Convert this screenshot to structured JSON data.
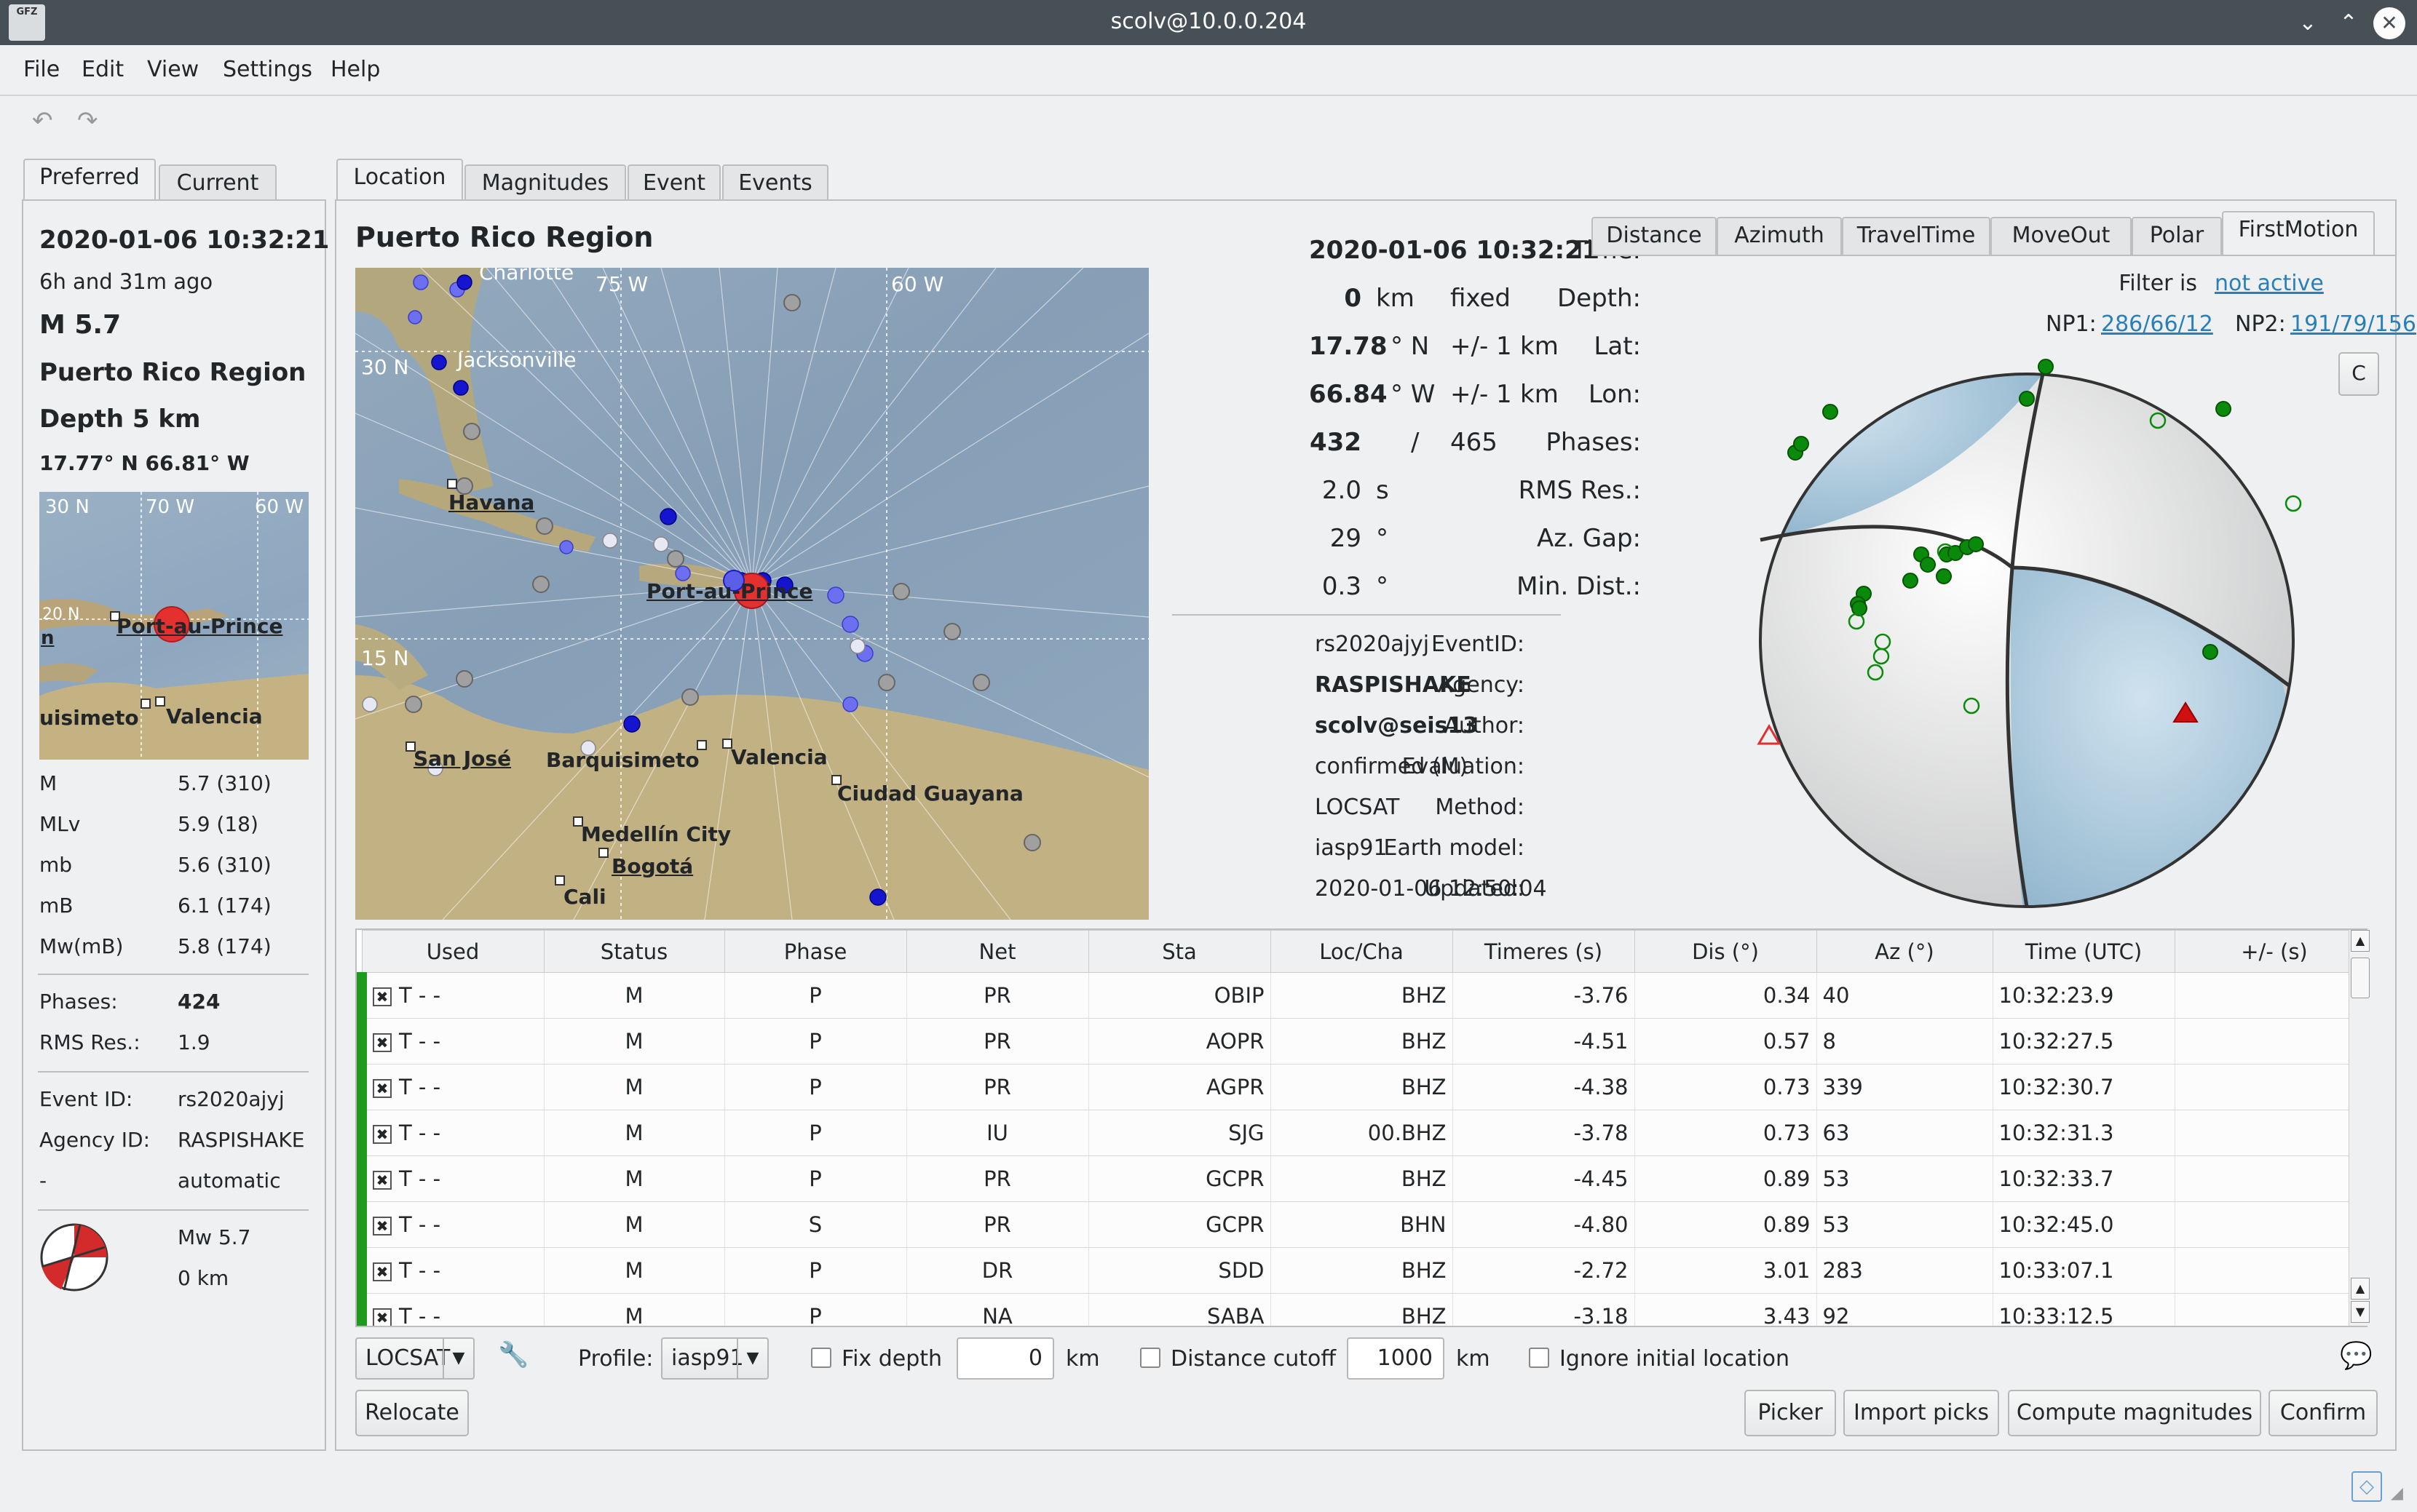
{
  "window": {
    "title": "scolv@10.0.0.204",
    "logo": "GFZ"
  },
  "menu": [
    "File",
    "Edit",
    "View",
    "Settings",
    "Help"
  ],
  "left_panel": {
    "tabs": [
      "Preferred",
      "Current"
    ],
    "time": "2020-01-06 10:32:21",
    "ago": "6h and 31m ago",
    "magnitude": "M  5.7",
    "region": "Puerto Rico Region",
    "depth": "Depth  5 km",
    "coords": "17.77° N   66.81° W",
    "map": {
      "lat1": "30 N",
      "lon1": "70 W",
      "lon2": "60 W",
      "lat2": "20 N",
      "city1": "Port-au-Prince",
      "city2": "Valencia",
      "city3": "uisimeto",
      "frag": "n"
    },
    "magnitudes": [
      {
        "type": "M",
        "value": "5.7 (310)"
      },
      {
        "type": "MLv",
        "value": "5.9 (18)"
      },
      {
        "type": "mb",
        "value": "5.6 (310)"
      },
      {
        "type": "mB",
        "value": "6.1 (174)"
      },
      {
        "type": "Mw(mB)",
        "value": "5.8 (174)"
      }
    ],
    "phases_label": "Phases:",
    "phases_value": "424",
    "rms_label": "RMS Res.:",
    "rms_value": "1.9",
    "event_id_label": "Event ID:",
    "event_id": "rs2020ajyj",
    "agency_label": "Agency ID:",
    "agency": "RASPISHAKE",
    "mode_label": "-",
    "mode": "automatic",
    "fm_mag": "Mw 5.7",
    "fm_depth": "0 km"
  },
  "main_tabs": [
    "Location",
    "Magnitudes",
    "Event",
    "Events"
  ],
  "location": {
    "region": "Puerto Rico Region",
    "map": {
      "lon_labels": [
        "75 W",
        "60 W"
      ],
      "lat_labels": [
        "30 N",
        "15 N"
      ],
      "cities": [
        "Charlotte",
        "Jacksonville",
        "Havana",
        "Port-au-Prince",
        "San José",
        "Barquisimeto",
        "Valencia",
        "Ciudad Guayana",
        "Medellín City",
        "Bogotá",
        "Cali"
      ]
    },
    "fields": {
      "time_label": "Time:",
      "time": "2020-01-06 10:32:21",
      "depth_label": "Depth:",
      "depth": "0",
      "depth_unit": "km",
      "depth_fixed": "fixed",
      "lat_label": "Lat:",
      "lat": "17.78",
      "lat_unit": "° N",
      "lat_err": "+/- 1",
      "lat_err_unit": "km",
      "lon_label": "Lon:",
      "lon": "66.84",
      "lon_unit": "° W",
      "lon_err": "+/- 1",
      "lon_err_unit": "km",
      "phases_label": "Phases:",
      "phases_used": "432",
      "phases_sep": "/",
      "phases_total": "465",
      "rms_label": "RMS Res.:",
      "rms": "2.0",
      "rms_unit": "s",
      "azgap_label": "Az. Gap:",
      "azgap": "29",
      "azgap_unit": "°",
      "mindist_label": "Min. Dist.:",
      "mindist": "0.3",
      "mindist_unit": "°"
    },
    "info": [
      {
        "label": "EventID:",
        "value": "rs2020ajyj",
        "bold": false
      },
      {
        "label": "Agency:",
        "value": "RASPISHAKE",
        "bold": true
      },
      {
        "label": "Author:",
        "value": "scolv@seis13",
        "bold": true
      },
      {
        "label": "Evaluation:",
        "value": "confirmed (M)",
        "bold": false
      },
      {
        "label": "Method:",
        "value": "LOCSAT",
        "bold": false
      },
      {
        "label": "Earth model:",
        "value": "iasp91",
        "bold": false
      },
      {
        "label": "Updated:",
        "value": "2020-01-06 12:50:04",
        "bold": false
      }
    ]
  },
  "plot_tabs": [
    "Distance",
    "Azimuth",
    "TravelTime",
    "MoveOut",
    "Polar",
    "FirstMotion"
  ],
  "firstmotion": {
    "filter_label": "Filter is",
    "filter_value": "not active",
    "np1_label": "NP1:",
    "np1": "286/66/12",
    "np2_label": "NP2:",
    "np2": "191/79/156",
    "corner_btn": "C"
  },
  "table": {
    "headers": [
      "Used",
      "Status",
      "Phase",
      "Net",
      "Sta",
      "Loc/Cha",
      "Timeres (s)",
      "Dis (°)",
      "Az (°)",
      "Time (UTC)",
      "+/- (s)"
    ],
    "rows": [
      {
        "used": "T  -  -",
        "status": "M",
        "phase": "P",
        "net": "PR",
        "sta": "OBIP",
        "cha": "BHZ",
        "res": "-3.76",
        "dis": "0.34",
        "az": "40",
        "time": "10:32:23.9"
      },
      {
        "used": "T  -  -",
        "status": "M",
        "phase": "P",
        "net": "PR",
        "sta": "AOPR",
        "cha": "BHZ",
        "res": "-4.51",
        "dis": "0.57",
        "az": "8",
        "time": "10:32:27.5"
      },
      {
        "used": "T  -  -",
        "status": "M",
        "phase": "P",
        "net": "PR",
        "sta": "AGPR",
        "cha": "BHZ",
        "res": "-4.38",
        "dis": "0.73",
        "az": "339",
        "time": "10:32:30.7"
      },
      {
        "used": "T  -  -",
        "status": "M",
        "phase": "P",
        "net": "IU",
        "sta": "SJG",
        "cha": "00.BHZ",
        "res": "-3.78",
        "dis": "0.73",
        "az": "63",
        "time": "10:32:31.3"
      },
      {
        "used": "T  -  -",
        "status": "M",
        "phase": "P",
        "net": "PR",
        "sta": "GCPR",
        "cha": "BHZ",
        "res": "-4.45",
        "dis": "0.89",
        "az": "53",
        "time": "10:32:33.7"
      },
      {
        "used": "T  -  -",
        "status": "M",
        "phase": "S",
        "net": "PR",
        "sta": "GCPR",
        "cha": "BHN",
        "res": "-4.80",
        "dis": "0.89",
        "az": "53",
        "time": "10:32:45.0"
      },
      {
        "used": "T  -  -",
        "status": "M",
        "phase": "P",
        "net": "DR",
        "sta": "SDD",
        "cha": "BHZ",
        "res": "-2.72",
        "dis": "3.01",
        "az": "283",
        "time": "10:33:07.1"
      },
      {
        "used": "T  -  -",
        "status": "M",
        "phase": "P",
        "net": "NA",
        "sta": "SABA",
        "cha": "BHZ",
        "res": "-3.18",
        "dis": "3.43",
        "az": "92",
        "time": "10:33:12.5"
      }
    ]
  },
  "controls": {
    "method": "LOCSAT",
    "profile_label": "Profile:",
    "profile": "iasp91",
    "fix_depth_label": "Fix depth",
    "fix_depth_value": "0",
    "fix_depth_unit": "km",
    "dist_cutoff_label": "Distance cutoff",
    "dist_cutoff_value": "1000",
    "dist_cutoff_unit": "km",
    "ignore_label": "Ignore initial location",
    "relocate": "Relocate",
    "picker": "Picker",
    "import": "Import picks",
    "compute": "Compute magnitudes",
    "confirm": "Confirm"
  }
}
